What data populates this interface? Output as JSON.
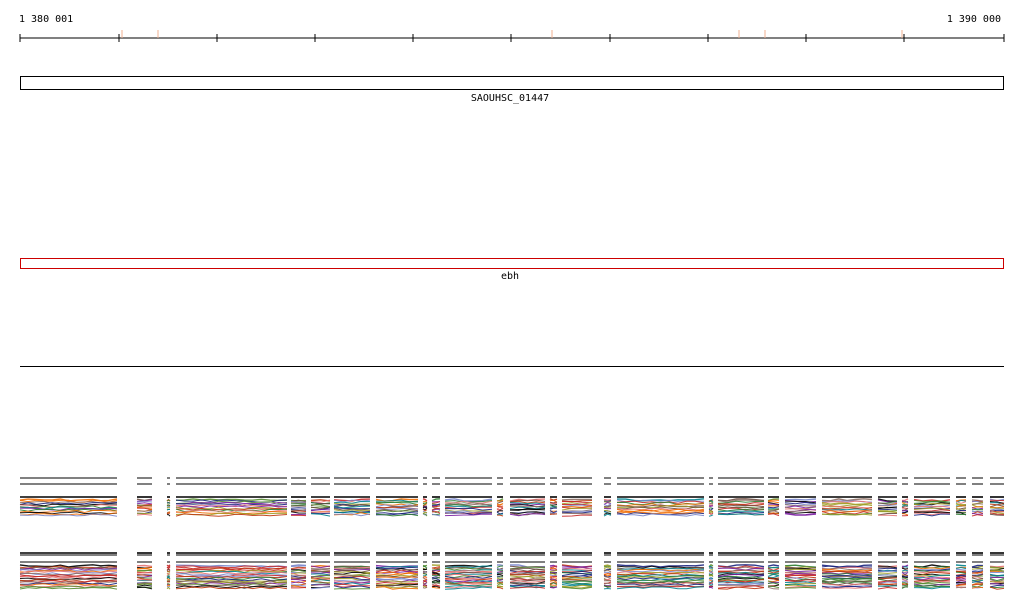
{
  "ruler": {
    "start_label": "1 380 001",
    "end_label": "1 390 000"
  },
  "tracks": {
    "gene_a": {
      "label": "SAOUHSC_01447",
      "color": "#000000"
    },
    "gene_b": {
      "label": "ebh",
      "color": "#cc0000"
    }
  },
  "alignment": {
    "line_colors": [
      "#000000",
      "#1a237e",
      "#7b1fa2",
      "#2e7d32",
      "#c62828",
      "#8d6e63",
      "#ef6c00",
      "#9e9d24",
      "#00838f",
      "#6d4c41",
      "#e57373",
      "#558b2f",
      "#bf360c",
      "#7986cb"
    ]
  }
}
